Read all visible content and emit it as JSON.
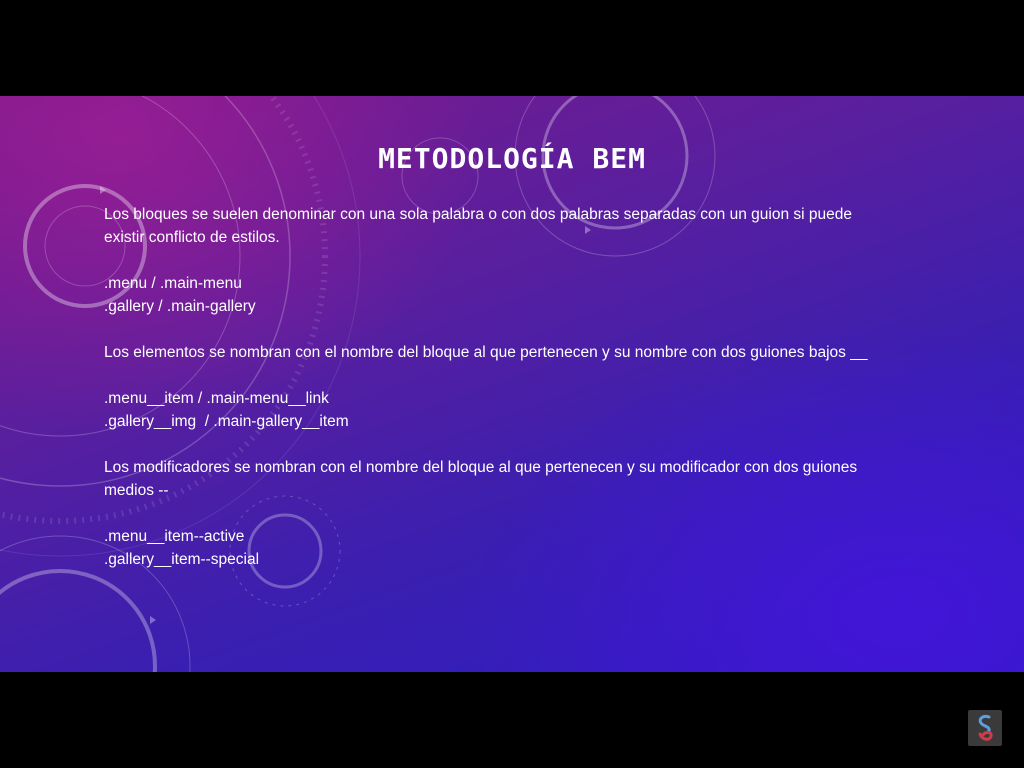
{
  "slide": {
    "title": "METODOLOGÍA BEM",
    "lines": [
      "Los bloques se suelen denominar con una sola palabra o con dos palabras separadas con un guion si puede",
      "existir conflicto de estilos.",
      "",
      ".menu / .main-menu",
      ".gallery / .main-gallery",
      "",
      "Los elementos se nombran con el nombre del bloque al que pertenecen y su nombre con dos guiones bajos __",
      "",
      ".menu__item / .main-menu__link",
      ".gallery__img  / .main-gallery__item",
      "",
      "Los modificadores se nombran con el nombre del bloque al que pertenecen y su modificador con dos guiones",
      "medios --",
      "",
      ".menu__item--active",
      ".gallery__item--special"
    ]
  },
  "colors": {
    "letterbox": "#000000",
    "text": "#ffffff",
    "gradient_magenta": "#7a1a8a",
    "gradient_blue": "#2d1cc4"
  },
  "icons": {
    "corner_logo": "video-logo-icon"
  }
}
